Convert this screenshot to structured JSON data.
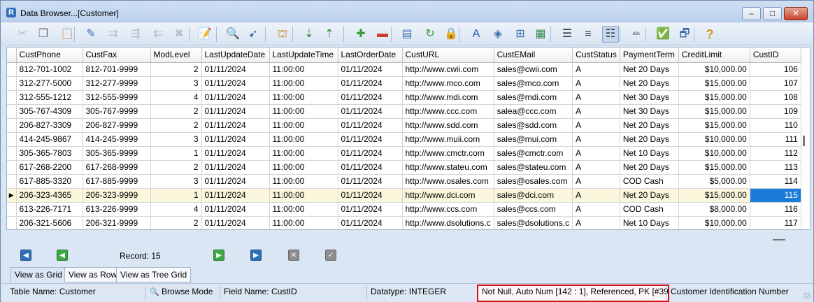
{
  "window": {
    "title": "Data Browser...[Customer]",
    "controls": {
      "minimize": "–",
      "maximize": "□",
      "close": "✕"
    }
  },
  "toolbar": {
    "buttons": [
      {
        "name": "cut-icon",
        "glyph": "✂",
        "color": "#8a8a8a",
        "disabled": true
      },
      {
        "name": "copy-icon",
        "glyph": "❐",
        "color": "#6b6b6b",
        "disabled": false
      },
      {
        "name": "paste-icon",
        "glyph": "📋",
        "color": "#8a8a8a",
        "disabled": true
      },
      {
        "name": "edit-pencil-icon",
        "glyph": "✎",
        "color": "#3b6fb0",
        "disabled": false
      },
      {
        "name": "insert-row-icon",
        "glyph": "⇉",
        "color": "#8a8a8a",
        "disabled": true
      },
      {
        "name": "append-row-icon",
        "glyph": "⇶",
        "color": "#8a8a8a",
        "disabled": true
      },
      {
        "name": "insert-before-icon",
        "glyph": "⇇",
        "color": "#8a8a8a",
        "disabled": true
      },
      {
        "name": "delete-x-icon",
        "glyph": "✖",
        "color": "#8a8a8a",
        "disabled": true
      },
      {
        "name": "edit-record-icon",
        "glyph": "📝",
        "color": "#c27c0e",
        "disabled": false
      },
      {
        "name": "find-icon",
        "glyph": "🔍",
        "color": "#3b6fb0",
        "disabled": false
      },
      {
        "name": "find-next-icon",
        "glyph": "➹",
        "color": "#3b6fb0",
        "disabled": false
      },
      {
        "name": "goto-icon",
        "glyph": "⛫",
        "color": "#c27c0e",
        "disabled": false
      },
      {
        "name": "sort-asc-icon",
        "glyph": "⇣",
        "color": "#3a8a3a",
        "disabled": false
      },
      {
        "name": "sort-desc-icon",
        "glyph": "⇡",
        "color": "#3a8a3a",
        "disabled": false
      },
      {
        "name": "filter-add-icon",
        "glyph": "✚",
        "color": "#3a9a3a",
        "disabled": false
      },
      {
        "name": "filter-remove-icon",
        "glyph": "▬",
        "color": "#cc3b2b",
        "disabled": false
      },
      {
        "name": "record-view-icon",
        "glyph": "▤",
        "color": "#3b6fb0",
        "disabled": false
      },
      {
        "name": "refresh-icon",
        "glyph": "↻",
        "color": "#3a9a3a",
        "disabled": false
      },
      {
        "name": "lock-icon",
        "glyph": "🔒",
        "color": "#c99a1e",
        "disabled": false
      },
      {
        "name": "font-icon",
        "glyph": "A",
        "color": "#1d5aa8",
        "disabled": false
      },
      {
        "name": "fill-color-icon",
        "glyph": "◈",
        "color": "#3b6fb0",
        "disabled": false
      },
      {
        "name": "fit-grid-icon",
        "glyph": "⊞",
        "color": "#3b6fb0",
        "disabled": false
      },
      {
        "name": "grid-lines-icon",
        "glyph": "▦",
        "color": "#2f8a4a",
        "disabled": false
      },
      {
        "name": "align-left-icon",
        "glyph": "☰",
        "color": "#333333",
        "disabled": false
      },
      {
        "name": "align-center-icon",
        "glyph": "≡",
        "color": "#333333",
        "disabled": false
      },
      {
        "name": "align-justify-icon",
        "glyph": "☷",
        "color": "#333333",
        "disabled": false
      },
      {
        "name": "spell-check-icon",
        "glyph": "ᴬᴮᶜ",
        "color": "#555555",
        "disabled": false
      },
      {
        "name": "view-form-icon",
        "glyph": "✅",
        "color": "#3b6fb0",
        "disabled": false
      },
      {
        "name": "view-tree-icon",
        "glyph": "🗗",
        "color": "#3b6fb0",
        "disabled": false
      },
      {
        "name": "help-icon",
        "glyph": "?",
        "color": "#c99a1e",
        "disabled": false
      }
    ]
  },
  "grid": {
    "columns": [
      "CustPhone",
      "CustFax",
      "ModLevel",
      "LastUpdateDate",
      "LastUpdateTime",
      "LastOrderDate",
      "CustURL",
      "CustEMail",
      "CustStatus",
      "PaymentTerm",
      "CreditLimit",
      "CustID"
    ],
    "current_row_marker": "▶",
    "rows": [
      [
        "812-701-1002",
        "812-701-9999",
        "2",
        "01/11/2024",
        "11:00:00",
        "01/11/2024",
        "http://www.cwii.com",
        "sales@cwii.com",
        "A",
        "Net 20 Days",
        "$10,000.00",
        "106"
      ],
      [
        "312-277-5000",
        "312-277-9999",
        "3",
        "01/11/2024",
        "11:00:00",
        "01/11/2024",
        "http://www.mco.com",
        "sales@mco.com",
        "A",
        "Net 20 Days",
        "$15,000.00",
        "107"
      ],
      [
        "312-555-1212",
        "312-555-9999",
        "4",
        "01/11/2024",
        "11:00:00",
        "01/11/2024",
        "http://www.mdi.com",
        "sales@mdi.com",
        "A",
        "Net 30 Days",
        "$15,000.00",
        "108"
      ],
      [
        "305-767-4309",
        "305-767-9999",
        "2",
        "01/11/2024",
        "11:00:00",
        "01/11/2024",
        "http://www.ccc.com",
        "salea@ccc.com",
        "A",
        "Net 30 Days",
        "$15,000.00",
        "109"
      ],
      [
        "206-827-3309",
        "206-827-9999",
        "2",
        "01/11/2024",
        "11:00:00",
        "01/11/2024",
        "http://www.sdd.com",
        "sales@sdd.com",
        "A",
        "Net 20 Days",
        "$15,000.00",
        "110"
      ],
      [
        "414-245-9867",
        "414-245-9999",
        "3",
        "01/11/2024",
        "11:00:00",
        "01/11/2024",
        "http://www.muii.com",
        "sales@mui.com",
        "A",
        "Net 20 Days",
        "$10,000.00",
        "111"
      ],
      [
        "305-365-7803",
        "305-365-9999",
        "1",
        "01/11/2024",
        "11:00:00",
        "01/11/2024",
        "http://www.cmctr.com",
        "sales@cmctr.com",
        "A",
        "Net 10 Days",
        "$10,000.00",
        "112"
      ],
      [
        "617-268-2200",
        "617-268-9999",
        "2",
        "01/11/2024",
        "11:00:00",
        "01/11/2024",
        "http://www.stateu.com",
        "sales@stateu.com",
        "A",
        "Net 20 Days",
        "$15,000.00",
        "113"
      ],
      [
        "617-885-3320",
        "617-885-9999",
        "3",
        "01/11/2024",
        "11:00:00",
        "01/11/2024",
        "http://www.osales.com",
        "sales@osales.com",
        "A",
        "COD Cash",
        "$5,000.00",
        "114"
      ],
      [
        "206-323-4365",
        "206-323-9999",
        "1",
        "01/11/2024",
        "11:00:00",
        "01/11/2024",
        "http://www.dci.com",
        "sales@dci.com",
        "A",
        "Net 20 Days",
        "$15,000.00",
        "115"
      ],
      [
        "613-226-7171",
        "613-226-9999",
        "4",
        "01/11/2024",
        "11:00:00",
        "01/11/2024",
        "http://www.ccs.com",
        "sales@ccs.com",
        "A",
        "COD Cash",
        "$8,000.00",
        "116"
      ],
      [
        "206-321-5606",
        "206-321-9999",
        "2",
        "01/11/2024",
        "11:00:00",
        "01/11/2024",
        "http://www.dsolutions.c",
        "sales@dsolutions.c",
        "A",
        "Net 10 Days",
        "$10,000.00",
        "117"
      ]
    ]
  },
  "navigator": {
    "first": "◀",
    "prev": "◀",
    "next": "▶",
    "last": "▶",
    "cancel": "✕",
    "post": "✓",
    "record_label": "Record: 15"
  },
  "tabs": [
    "View as Grid",
    "View as Row",
    "View as Tree Grid"
  ],
  "status": {
    "table_name": "Table Name: Customer",
    "mode": "Browse Mode",
    "mode_icon": "🔍",
    "field_name": "Field Name: CustID",
    "datatype": "Datatype: INTEGER",
    "attributes": "Not Null, Auto Num [142 : 1], Referenced, PK [#39",
    "description": "Customer Identification Number"
  }
}
